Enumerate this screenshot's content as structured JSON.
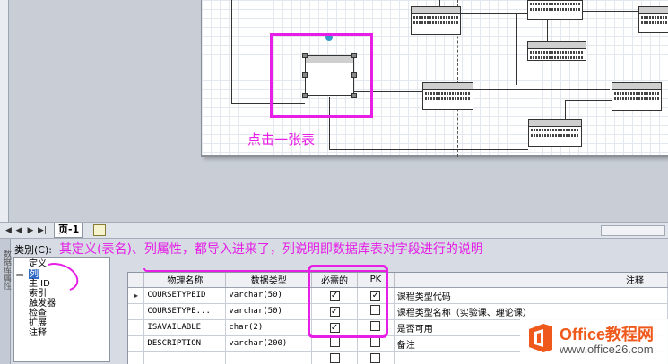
{
  "annotations": {
    "click_table": "点击一张表",
    "main_note": "其定义(表名)、列属性，都导入进来了，列说明即数据库表对字段进行的说明"
  },
  "page_tabs": {
    "active_tab": "页-1"
  },
  "panel": {
    "vertical_tab_label": "数据库属性",
    "category_label": "类别(C):",
    "categories": [
      {
        "label": "定义",
        "selected": false
      },
      {
        "label": "列",
        "selected": true
      },
      {
        "label": "主 ID",
        "selected": false
      },
      {
        "label": "索引",
        "selected": false
      },
      {
        "label": "触发器",
        "selected": false
      },
      {
        "label": "检查",
        "selected": false
      },
      {
        "label": "扩展",
        "selected": false
      },
      {
        "label": "注释",
        "selected": false
      }
    ]
  },
  "grid": {
    "headers": [
      "物理名称",
      "数据类型",
      "必需的",
      "PK",
      "注释"
    ],
    "rows": [
      {
        "physical_name": "COURSETYPEID",
        "data_type": "varchar(50)",
        "required": true,
        "pk": true,
        "comment": "课程类型代码"
      },
      {
        "physical_name": "COURSETYPE...",
        "data_type": "varchar(50)",
        "required": true,
        "pk": false,
        "comment": "课程类型名称（实验课、理论课）"
      },
      {
        "physical_name": "ISAVAILABLE",
        "data_type": "char(2)",
        "required": true,
        "pk": false,
        "comment": "是否可用"
      },
      {
        "physical_name": "DESCRIPTION",
        "data_type": "varchar(200)",
        "required": false,
        "pk": false,
        "comment": "备注"
      }
    ]
  },
  "watermark": {
    "title": "Office教程网",
    "url": "www.office26.com"
  },
  "colors": {
    "annotation": "#e61ee6",
    "selection": "#3169c6",
    "watermark_orange": "#ef5a1c"
  }
}
